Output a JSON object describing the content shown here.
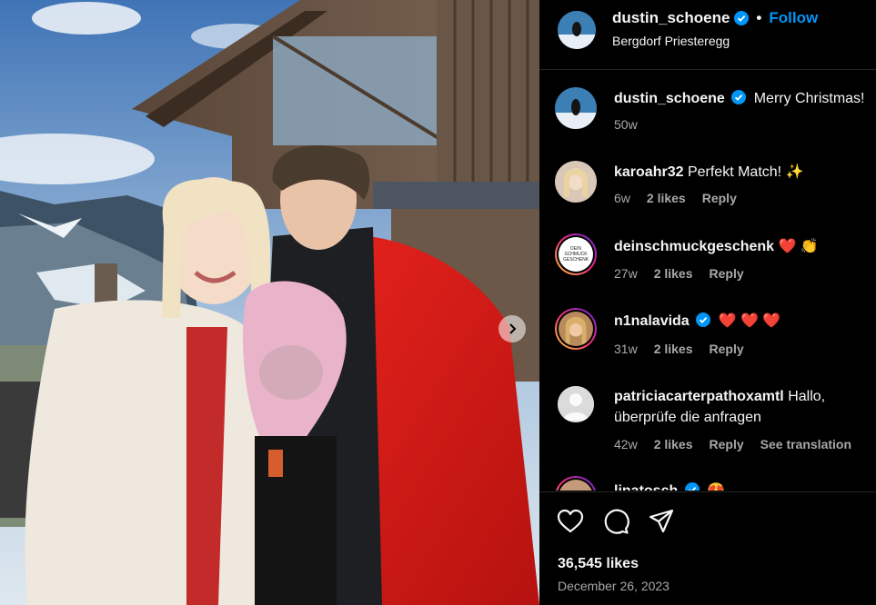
{
  "post": {
    "author": "dustin_schoene",
    "follow_label": "Follow",
    "location": "Bergdorf Priesteregg",
    "separator": "•"
  },
  "comments": [
    {
      "user": "dustin_schoene",
      "verified": true,
      "text": "Merry Christmas!",
      "time": "50w",
      "likes": "",
      "reply": "",
      "extra": ""
    },
    {
      "user": "karoahr32",
      "verified": false,
      "text": "Perfekt Match! ✨",
      "time": "6w",
      "likes": "2 likes",
      "reply": "Reply",
      "extra": ""
    },
    {
      "user": "deinschmuckgeschenk",
      "verified": false,
      "text": "❤️ 👏",
      "time": "27w",
      "likes": "2 likes",
      "reply": "Reply",
      "extra": ""
    },
    {
      "user": "n1nalavida",
      "verified": true,
      "text": "❤️ ❤️ ❤️",
      "time": "31w",
      "likes": "2 likes",
      "reply": "Reply",
      "extra": ""
    },
    {
      "user": "patriciacarterpathoxamtl",
      "verified": false,
      "text": "Hallo, überprüfe die anfragen",
      "time": "42w",
      "likes": "2 likes",
      "reply": "Reply",
      "extra": "See translation"
    },
    {
      "user": "linatosch",
      "verified": true,
      "text": "😍",
      "time": "",
      "likes": "",
      "reply": "",
      "extra": ""
    }
  ],
  "brand_avatar_text": "DEIN SCHMUCK GESCHENK",
  "actions": {
    "icons": [
      "heart-icon",
      "comment-icon",
      "share-icon"
    ],
    "likes_count": "36,545 likes",
    "date": "December 26, 2023"
  },
  "colors": {
    "background": "#000000",
    "link": "#0095f6",
    "muted": "#a8a8a8",
    "verified": "#0095f6"
  }
}
